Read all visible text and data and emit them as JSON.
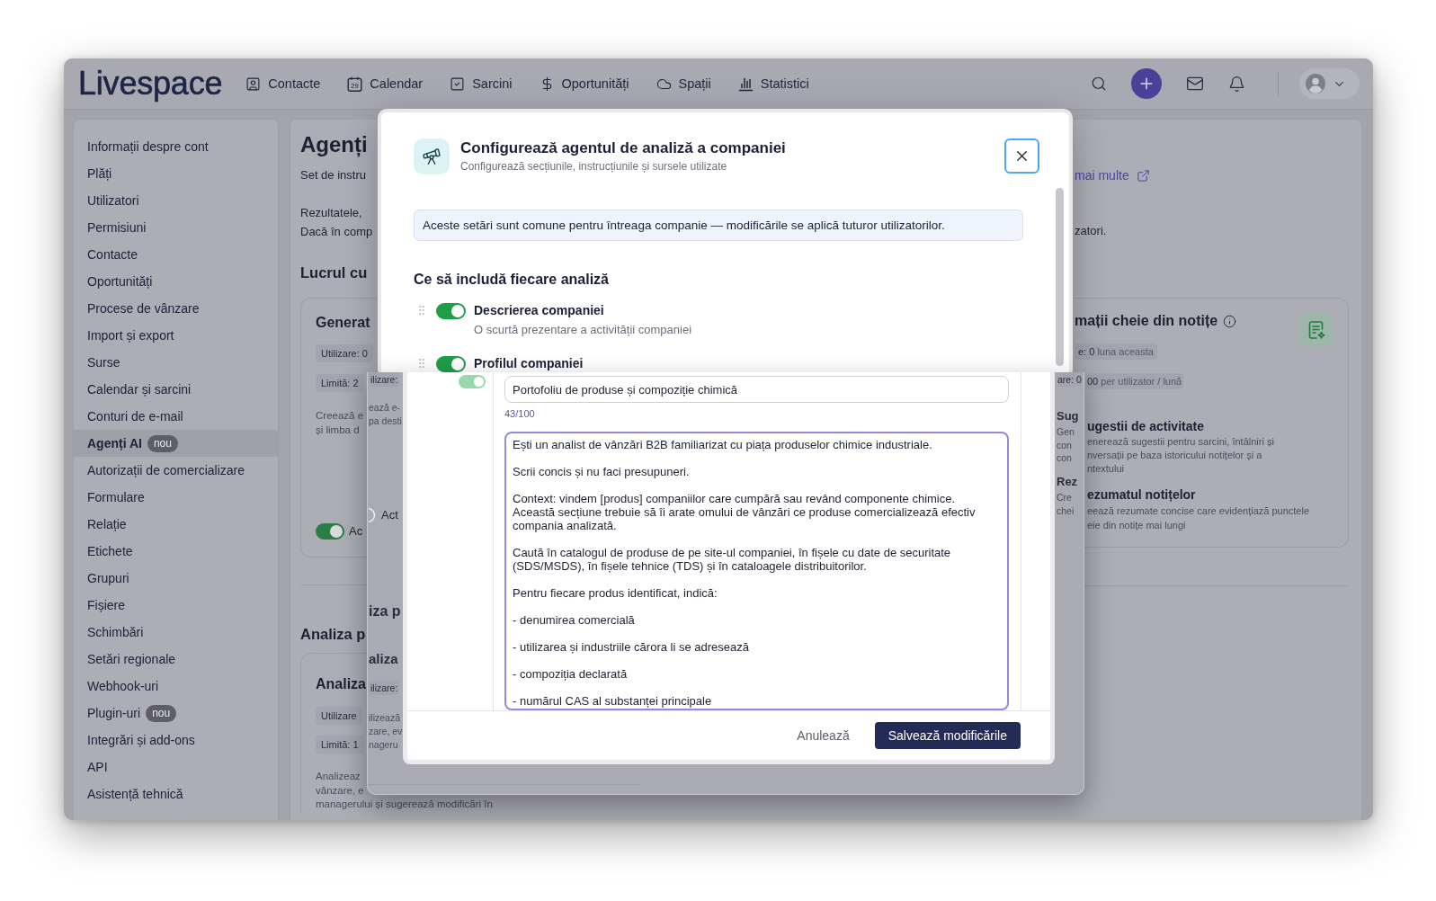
{
  "app": {
    "logo": "Livespace"
  },
  "nav": {
    "items": [
      {
        "kind": "contacts",
        "label": "Contacte"
      },
      {
        "kind": "calendar",
        "label": "Calendar",
        "icon_text": "29"
      },
      {
        "kind": "tasks",
        "label": "Sarcini"
      },
      {
        "kind": "deals",
        "label": "Oportunități"
      },
      {
        "kind": "spaces",
        "label": "Spații"
      },
      {
        "kind": "stats",
        "label": "Statistici"
      }
    ]
  },
  "sidebar": {
    "items": [
      {
        "label": "Informații despre cont",
        "selected": false
      },
      {
        "label": "Plăți",
        "selected": false
      },
      {
        "label": "Utilizatori",
        "selected": false
      },
      {
        "label": "Permisiuni",
        "selected": false
      },
      {
        "label": "Contacte",
        "selected": false
      },
      {
        "label": "Oportunități",
        "selected": false
      },
      {
        "label": "Procese de vânzare",
        "selected": false
      },
      {
        "label": "Import și export",
        "selected": false
      },
      {
        "label": "Surse",
        "selected": false
      },
      {
        "label": "Calendar și sarcini",
        "selected": false
      },
      {
        "label": "Conturi de e-mail",
        "selected": false
      },
      {
        "label": "Agenți AI",
        "selected": true,
        "badge": "nou"
      },
      {
        "label": "Autorizații de comercializare",
        "selected": false
      },
      {
        "label": "Formulare",
        "selected": false
      },
      {
        "label": "Relație",
        "selected": false
      },
      {
        "label": "Etichete",
        "selected": false
      },
      {
        "label": "Grupuri",
        "selected": false
      },
      {
        "label": "Fișiere",
        "selected": false
      },
      {
        "label": "Schimbări",
        "selected": false
      },
      {
        "label": "Setări regionale",
        "selected": false
      },
      {
        "label": "Webhook-uri",
        "selected": false
      },
      {
        "label": "Plugin-uri",
        "selected": false,
        "badge": "nou"
      },
      {
        "label": "Integrări și add-ons",
        "selected": false
      },
      {
        "label": "API",
        "selected": false
      },
      {
        "label": "Asistență tehnică",
        "selected": false
      }
    ]
  },
  "page": {
    "left_column": {
      "title": "Agenți",
      "description": "Set de instru",
      "notice_lines": [
        "Rezultatele,",
        "Dacă în comp"
      ],
      "sections": [
        {
          "title": "Lucrul cu",
          "card": {
            "title": "Generat",
            "usage": "Utilizare: 0",
            "limit": "Limită: 2",
            "description_lines": [
              "Creează e",
              "și limba d"
            ],
            "toggle": {
              "on": true,
              "label": "Ac"
            }
          }
        },
        {
          "title": "Analiza p",
          "card": {
            "title": "Analiza",
            "usage": "Utilizare",
            "limit": "Limită: 1",
            "description_lines": [
              "Analizeaz",
              "vânzare, e",
              "managerului și sugerează modificări în"
            ]
          }
        }
      ]
    },
    "right_column": {
      "link": "mai multe",
      "notice_end": "zatori.",
      "card": {
        "title": "mații cheie din notițe",
        "usage": {
          "value": "e: 0",
          "period": "luna aceasta"
        },
        "limit": {
          "value": "00",
          "period": "per utilizator / lună"
        },
        "features": [
          {
            "title": "ugestii de activitate",
            "description_lines": [
              "enerează sugestii pentru sarcini, întâlniri și",
              "nversații pe baza istoricului notițelor și a",
              "ntextului"
            ]
          },
          {
            "title": "ezumatul notițelor",
            "description_lines": [
              "eează rezumate concise care evidențiază punctele",
              "eie din notițe mai lungi"
            ]
          }
        ]
      }
    }
  },
  "modal": {
    "title": "Configurează agentul de analiză a companiei",
    "subtitle": "Configurează secțiunile, instrucțiunile și sursele utilizate",
    "notice": "Aceste setări sunt comune pentru întreaga companie — modificările se aplică tuturor utilizatorilor.",
    "section_title": "Ce să includă fiecare analiză",
    "sections": [
      {
        "label": "Descrierea companiei",
        "description": "O scurtă prezentare a activității companiei",
        "on": true
      },
      {
        "label": "Profilul companiei",
        "on": true
      }
    ]
  },
  "detail_view": {
    "left_strip": {
      "card": {
        "usage": "ilizare:",
        "description_lines": [
          "ează e-",
          "pa desti"
        ],
        "toggle": {
          "on": false,
          "label": "Act"
        }
      },
      "section_title": "iza p",
      "section_card": {
        "title": "aliza",
        "usage": "ilizare:",
        "description_lines": [
          "ilizează",
          "zare, ev",
          "nageru"
        ]
      }
    },
    "right_strip": {
      "usage": "are: 0",
      "features": [
        {
          "title": "Sug",
          "description_lines": [
            "Gen",
            "con",
            "con"
          ]
        },
        {
          "title": "Rez",
          "description_lines": [
            "Cre",
            "chei"
          ]
        }
      ]
    },
    "section_toggle": {
      "on": true
    },
    "name_field": {
      "value": "Portofoliu de produse și compoziție chimică"
    },
    "char_count": "43/100",
    "prompt_field": {
      "paragraphs": [
        [
          "Ești un analist de vânzări B2B familiarizat cu piața produselor chimice industriale."
        ],
        [
          "Scrii concis și nu faci presupuneri."
        ],
        [
          "Context: vindem [produs] companiilor care cumpără sau revând componente chimice.",
          "Această secțiune trebuie să îi arate omului de vânzări ce produse comercializează efectiv",
          "compania analizată."
        ],
        [
          "Caută în catalogul de produse de pe site-ul companiei, în fișele cu date de securitate",
          "(SDS/MSDS), în fișele tehnice (TDS) și în cataloagele distribuitorilor."
        ],
        [
          "Pentru fiecare produs identificat, indică:"
        ],
        [
          "- denumirea comercială"
        ],
        [
          "- utilizarea și industriile cărora li se adresează"
        ],
        [
          "- compoziția declarată"
        ],
        [
          "- numărul CAS al substanței principale"
        ]
      ]
    },
    "buttons": [
      {
        "kind": "secondary",
        "label": "Anulează"
      },
      {
        "kind": "primary",
        "label": "Salvează modificările"
      }
    ]
  }
}
